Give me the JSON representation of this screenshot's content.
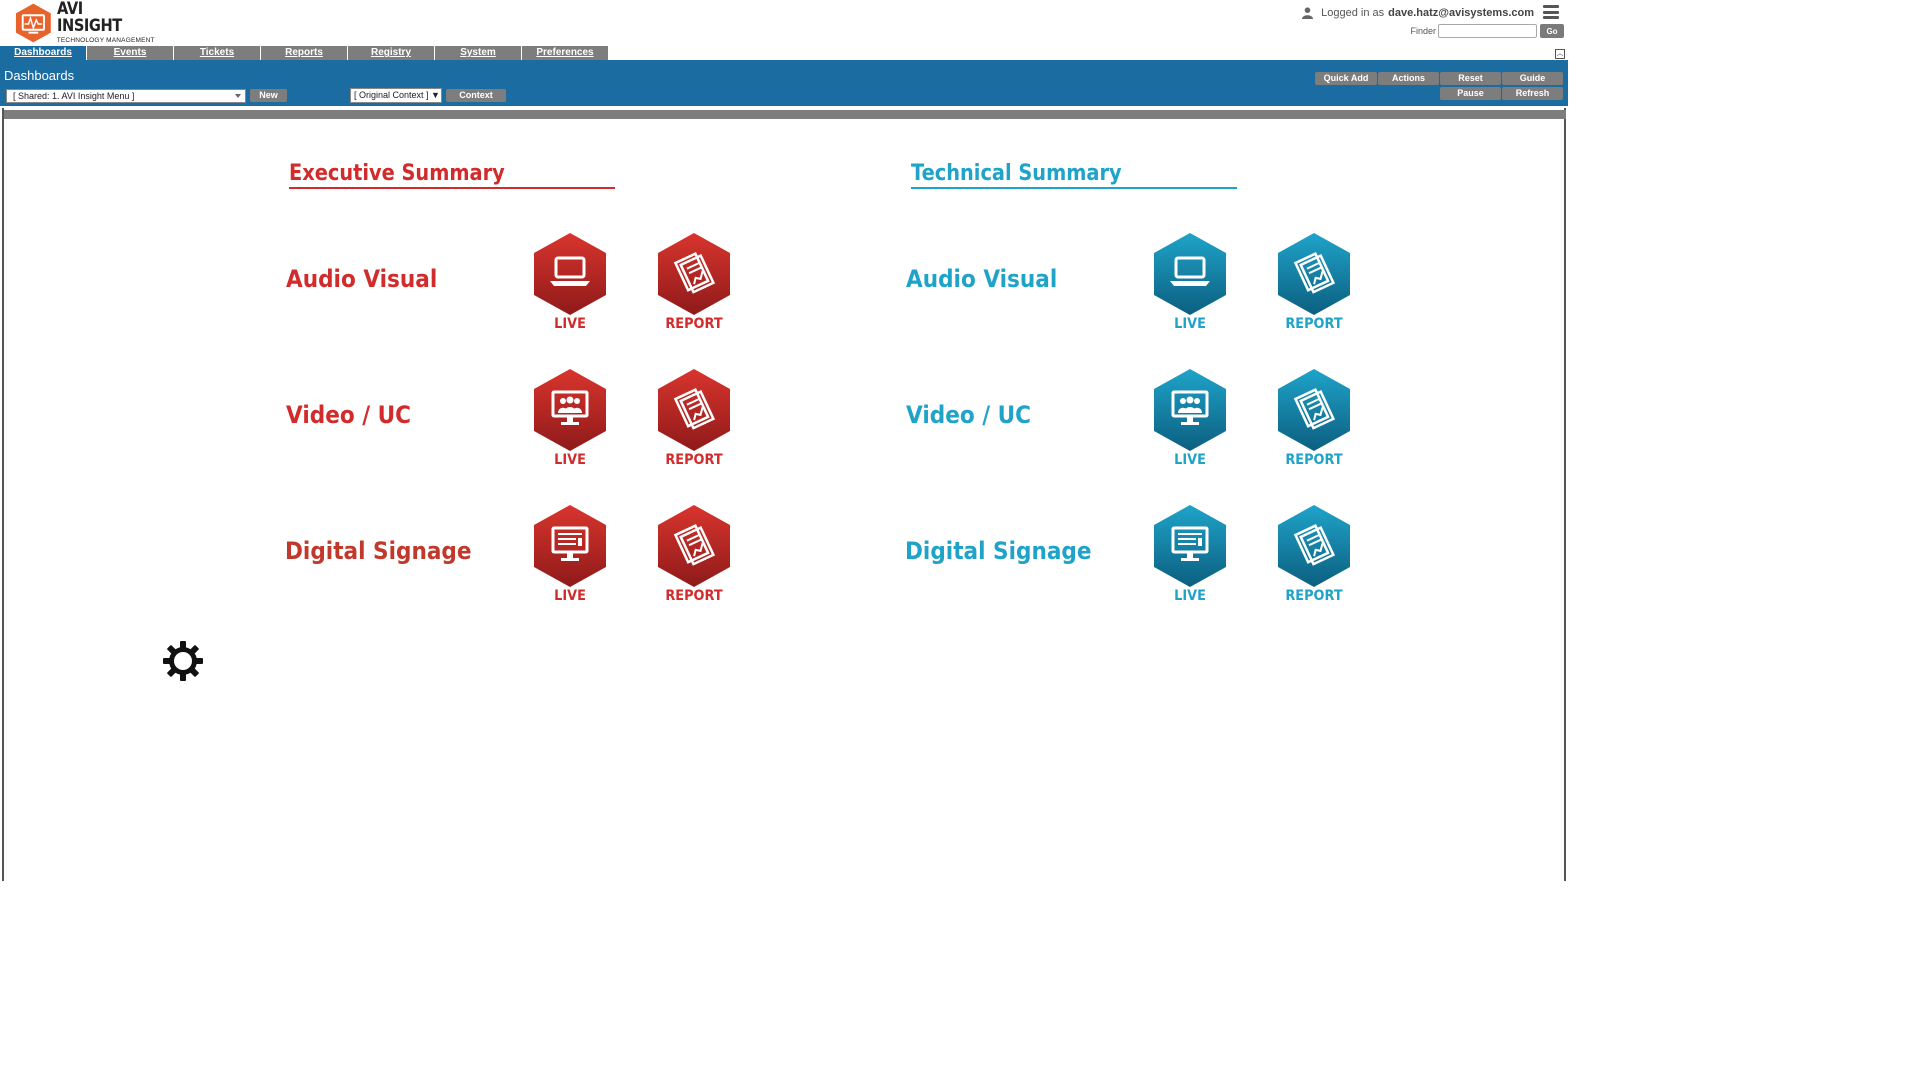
{
  "brand": {
    "title": "AVI INSIGHT",
    "subtitle": "TECHNOLOGY MANAGEMENT",
    "color": "#e8622c"
  },
  "user": {
    "prefix": "Logged in as",
    "email": "dave.hatz@avisystems.com",
    "icon": "user-icon"
  },
  "finder": {
    "label": "Finder",
    "value": "",
    "go_label": "Go"
  },
  "tabs": [
    {
      "label": "Dashboards",
      "active": true
    },
    {
      "label": "Events"
    },
    {
      "label": "Tickets"
    },
    {
      "label": "Reports"
    },
    {
      "label": "Registry"
    },
    {
      "label": "System"
    },
    {
      "label": "Preferences"
    }
  ],
  "toolbar": {
    "title": "Dashboards",
    "menu_select": "[ Shared: 1. AVI Insight Menu ]",
    "new_label": "New",
    "context_select": "[ Original Context ] ▼",
    "context_label": "Context",
    "quick_add": "Quick Add",
    "actions": "Actions",
    "reset": "Reset",
    "guide": "Guide",
    "pause": "Pause",
    "refresh": "Refresh",
    "color": "#1b6ca0"
  },
  "executive": {
    "title": "Executive Summary",
    "color": "#d22b2b",
    "rows": [
      {
        "label": "Audio Visual",
        "live": "LIVE",
        "report": "REPORT",
        "live_icon": "laptop-icon"
      },
      {
        "label": "Video / UC",
        "live": "LIVE",
        "report": "REPORT",
        "live_icon": "video-conference-icon"
      },
      {
        "label": "Digital Signage",
        "live": "LIVE",
        "report": "REPORT",
        "live_icon": "signage-monitor-icon"
      }
    ]
  },
  "technical": {
    "title": "Technical Summary",
    "color": "#1fa3c9",
    "rows": [
      {
        "label": "Audio Visual",
        "live": "LIVE",
        "report": "REPORT",
        "live_icon": "laptop-icon"
      },
      {
        "label": "Video / UC",
        "live": "LIVE",
        "report": "REPORT",
        "live_icon": "video-conference-icon"
      },
      {
        "label": "Digital Signage",
        "live": "LIVE",
        "report": "REPORT",
        "live_icon": "signage-monitor-icon"
      }
    ]
  },
  "settings": {
    "icon": "gear-icon"
  }
}
